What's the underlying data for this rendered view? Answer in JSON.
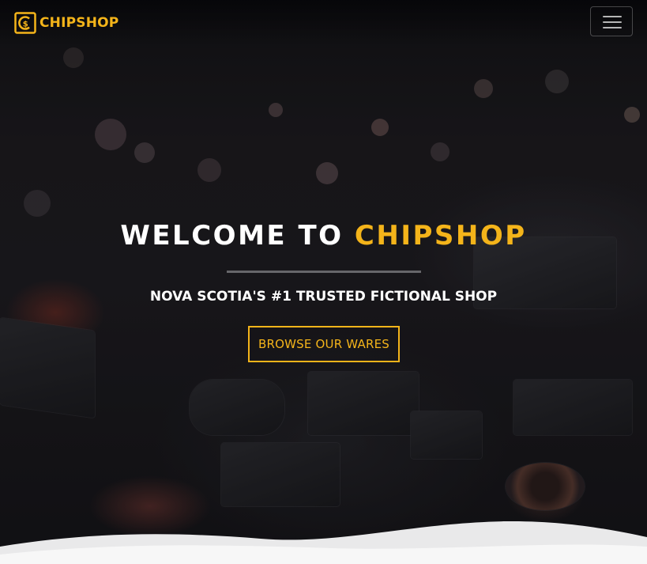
{
  "brand": {
    "name": "CHIPSHOP",
    "logo_icon": "chipshop-logo-icon",
    "accent_color": "#f4b41a"
  },
  "navbar": {
    "toggler_icon": "hamburger-menu-icon"
  },
  "hero": {
    "headline_prefix": "WELCOME TO",
    "headline_accent": "CHIPSHOP",
    "subheading": "NOVA SCOTIA'S #1 TRUSTED FICTIONAL SHOP",
    "cta_label": "BROWSE OUR WARES",
    "background": "circuit-board-photo"
  }
}
